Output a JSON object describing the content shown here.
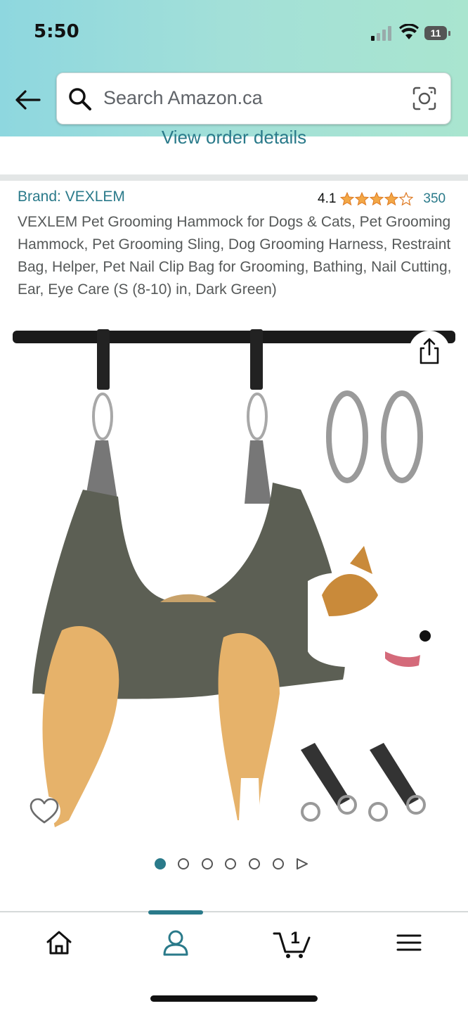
{
  "status_bar": {
    "time": "5:50",
    "battery_level": "11",
    "battery_color": "#e2434b"
  },
  "header": {
    "back_icon": "back-arrow-icon",
    "search_placeholder": "Search Amazon.ca",
    "camera_icon": "camera-scan-icon",
    "gradient_colors": [
      "#8ed7df",
      "#a9e5cf"
    ]
  },
  "order_details_link": "View order details",
  "product": {
    "brand": "Brand: VEXLEM",
    "rating_value": "4.1",
    "rating_stars": 4.1,
    "review_count": "350",
    "title": "VEXLEM Pet Grooming Hammock for Dogs & Cats, Pet Grooming Hammock, Pet Grooming Sling, Dog Grooming Harness, Restraint Bag, Helper, Pet Nail Clip Bag for Grooming, Bathing, Nail Cutting, Ear, Eye Care (S (8-10) in, Dark Green)",
    "image_icon_share": "share-icon",
    "image_icon_wishlist": "heart-icon",
    "image_count": 6,
    "current_image_index": 0
  },
  "bottom_nav": {
    "items": [
      {
        "name": "home",
        "icon": "home-icon"
      },
      {
        "name": "account",
        "icon": "account-icon",
        "active": true
      },
      {
        "name": "cart",
        "icon": "cart-icon",
        "badge": "1"
      },
      {
        "name": "menu",
        "icon": "menu-icon"
      }
    ],
    "accent_color": "#2a7a8a"
  }
}
